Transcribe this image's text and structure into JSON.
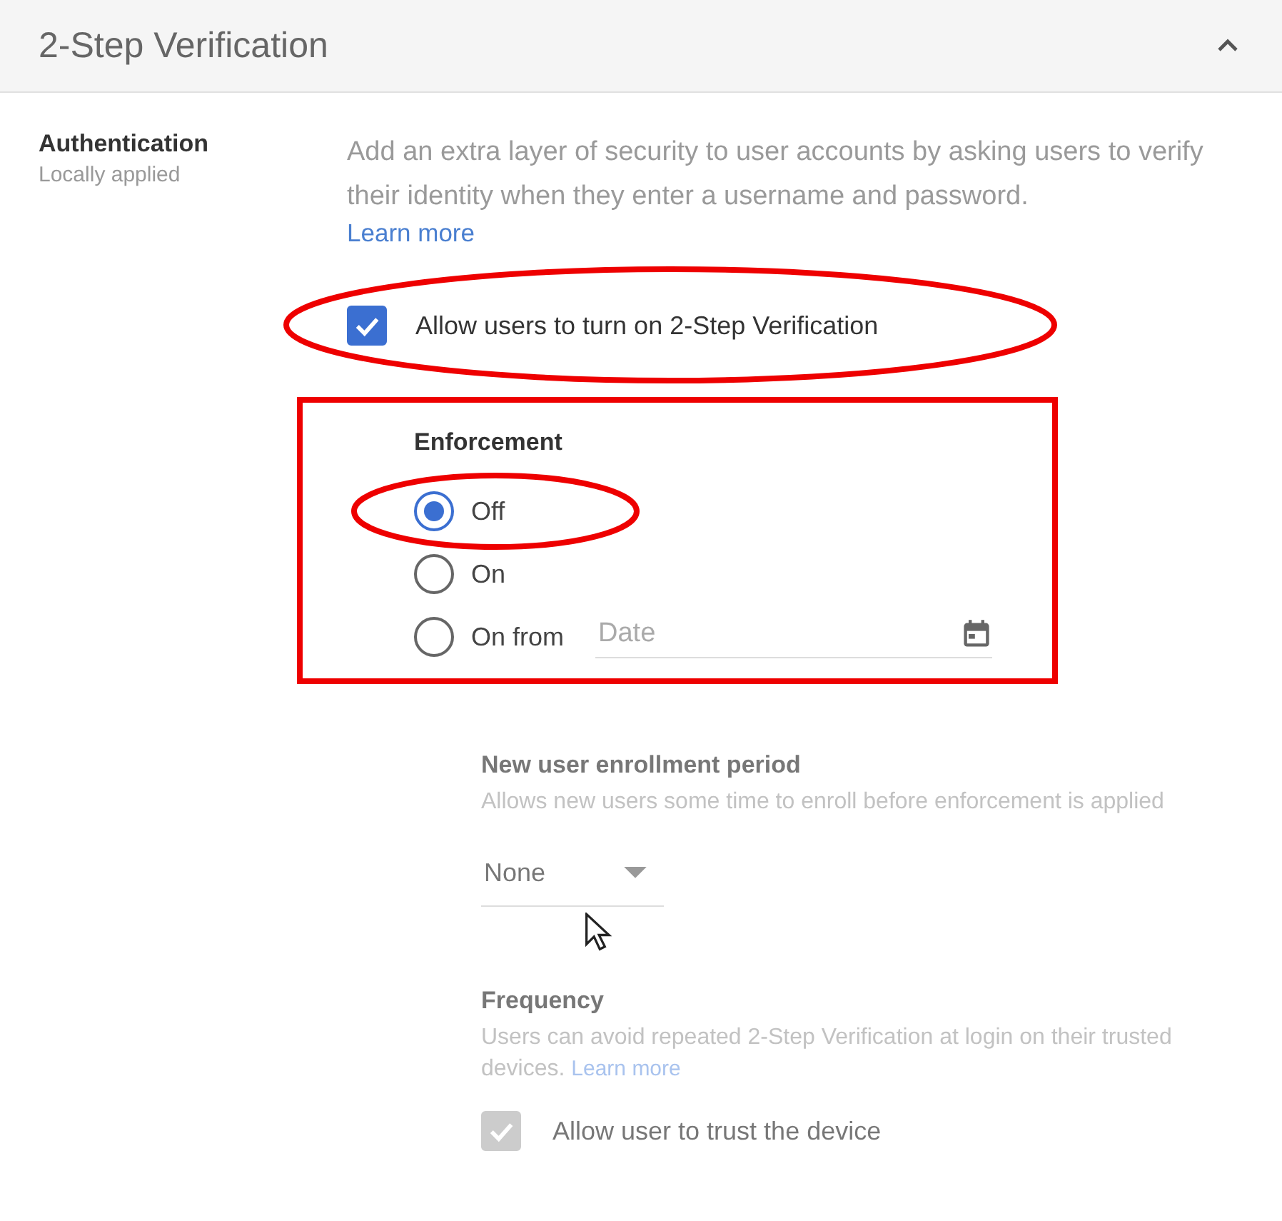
{
  "section": {
    "title": "2-Step Verification",
    "expanded": true
  },
  "setting": {
    "label": "Authentication",
    "sublabel": "Locally applied"
  },
  "description": "Add an extra layer of security to user accounts by asking users to verify their identity when they enter a username and password.",
  "learn_more": "Learn more",
  "allow_checkbox": {
    "label": "Allow users to turn on 2-Step Verification",
    "checked": true,
    "circled": true
  },
  "enforcement": {
    "heading": "Enforcement",
    "boxed": true,
    "options": [
      {
        "label": "Off",
        "selected": true,
        "circled": true,
        "kind": "plain"
      },
      {
        "label": "On",
        "selected": false,
        "circled": false,
        "kind": "plain"
      },
      {
        "label": "On from",
        "selected": false,
        "circled": false,
        "kind": "date"
      }
    ],
    "date_placeholder": "Date"
  },
  "enrollment": {
    "heading": "New user enrollment period",
    "description": "Allows new users some time to enroll before enforcement is applied",
    "value": "None",
    "disabled": true
  },
  "frequency": {
    "heading": "Frequency",
    "description": "Users can avoid repeated 2-Step Verification at login on their trusted devices.",
    "link": "Learn more",
    "disabled": true,
    "checkbox": {
      "label": "Allow user to trust the device",
      "checked": true,
      "disabled": true
    }
  }
}
